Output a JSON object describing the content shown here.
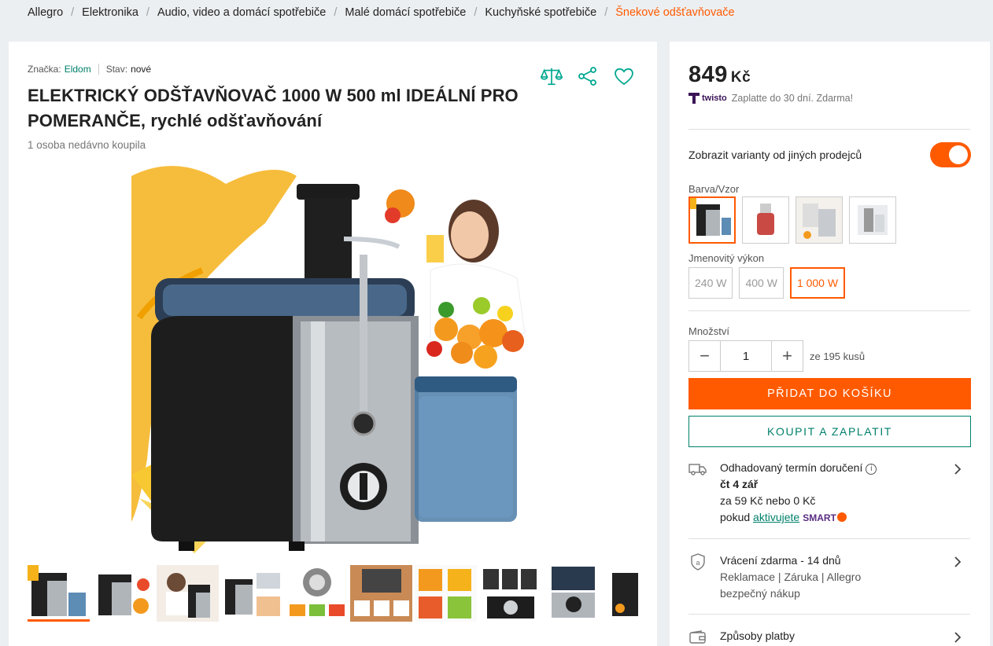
{
  "breadcrumbs": [
    "Allegro",
    "Elektronika",
    "Audio, video a domácí spotřebiče",
    "Malé domácí spotřebiče",
    "Kuchyňské spotřebiče",
    "Šnekové odšťavňovače"
  ],
  "product": {
    "brand_label": "Značka:",
    "brand": "Eldom",
    "condition_label": "Stav:",
    "condition": "nové",
    "title": "ELEKTRICKÝ ODŠŤAVŇOVAČ 1000 W 500 ml IDEÁLNÍ PRO POMERANČE, rychlé odšťavňování",
    "bought": "1 osoba nedávno koupila",
    "icons": [
      "compare-scales-icon",
      "share-icon",
      "heart-icon"
    ],
    "thumbnail_count": 10
  },
  "purchase": {
    "price": "849",
    "currency": "Kč",
    "twisto_brand": "twisto",
    "twisto_text": "Zaplatte do 30 dní. Zdarma!",
    "toggle_label": "Zobrazit varianty od jiných prodejců",
    "toggle_on": true,
    "color_label": "Barva/Vzor",
    "power_label": "Jmenovitý výkon",
    "powers": [
      "240 W",
      "400 W",
      "1 000 W"
    ],
    "power_selected": "1 000 W",
    "qty_label": "Množství",
    "qty": "1",
    "qty_note": "ze 195 kusů",
    "add_to_cart": "PŘIDAT DO KOŠÍKU",
    "buy_now": "KOUPIT A ZAPLATIT",
    "accent": "#ff5a00",
    "secondary": "#00806b"
  },
  "delivery": {
    "title": "Odhadovaný termín doručení",
    "date": "čt 4 zář",
    "cost": "za 59 Kč nebo 0 Kč",
    "activate_prefix": "pokud",
    "activate_link": "aktivujete",
    "smart": "SMART"
  },
  "returns": {
    "title": "Vrácení zdarma - 14 dnů",
    "line1": "Reklamace | Záruka | Allegro",
    "line2": "bezpečný nákup"
  },
  "payment": {
    "title": "Způsoby platby"
  }
}
